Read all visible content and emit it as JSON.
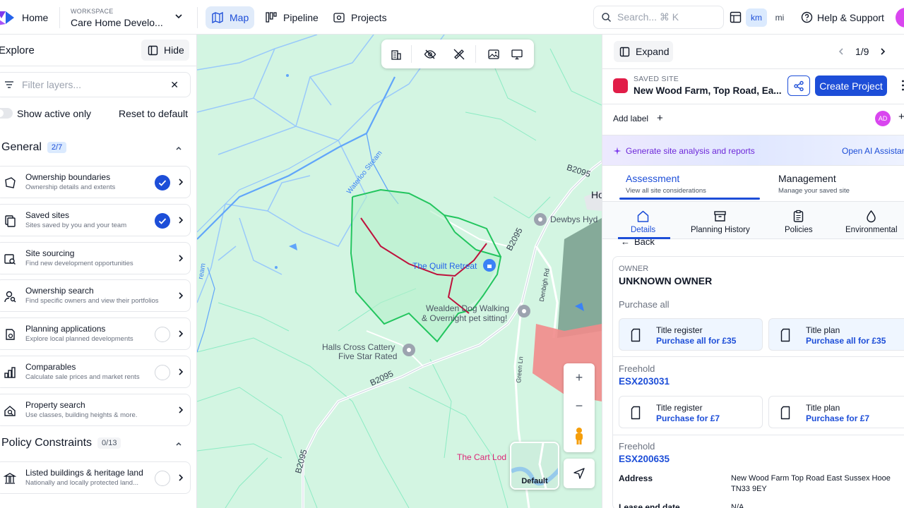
{
  "topbar": {
    "home": "Home",
    "workspace_caption": "WORKSPACE",
    "workspace_name": "Care Home Develo...",
    "nav": [
      {
        "label": "Map",
        "active": true
      },
      {
        "label": "Pipeline",
        "active": false
      },
      {
        "label": "Projects",
        "active": false
      }
    ],
    "search_placeholder": "Search... ⌘ K",
    "units": [
      {
        "label": "km",
        "active": true
      },
      {
        "label": "mi",
        "active": false
      }
    ],
    "help": "Help & Support"
  },
  "explore": {
    "title": "Explore",
    "hide": "Hide",
    "filter_placeholder": "Filter layers...",
    "show_active_only": "Show active only",
    "reset": "Reset to default",
    "sections": [
      {
        "title": "General",
        "badge": "2/7",
        "layers": [
          {
            "title": "Ownership boundaries",
            "subtitle": "Ownership details and extents",
            "checked": true,
            "icon": "boundary-icon"
          },
          {
            "title": "Saved sites",
            "subtitle": "Sites saved by you and your team",
            "checked": true,
            "icon": "saved-sites-icon"
          },
          {
            "title": "Site sourcing",
            "subtitle": "Find new development opportunities",
            "checked": null,
            "icon": "site-sourcing-icon"
          },
          {
            "title": "Ownership search",
            "subtitle": "Find specific owners and view their portfolios",
            "checked": null,
            "icon": "person-search-icon"
          },
          {
            "title": "Planning applications",
            "subtitle": "Explore local planned developments",
            "checked": false,
            "icon": "planning-icon"
          },
          {
            "title": "Comparables",
            "subtitle": "Calculate sale prices and market rents",
            "checked": false,
            "icon": "comparables-icon"
          },
          {
            "title": "Property search",
            "subtitle": "Use classes, building heights & more.",
            "checked": null,
            "icon": "property-search-icon"
          }
        ]
      },
      {
        "title": "Policy Constraints",
        "badge": "0/13",
        "layers": [
          {
            "title": "Listed buildings & heritage land",
            "subtitle": "Nationally and locally protected land...",
            "checked": false,
            "icon": "heritage-icon"
          }
        ]
      }
    ]
  },
  "map": {
    "labels": {
      "road_b2095_top": "B2095",
      "road_b2095_mid": "B2095",
      "road_b2095_low": "B2095",
      "road_b2095_bottom": "B2095",
      "stream": "Waterloo Stream",
      "stream_left": "ream",
      "denbigh": "Denbigh Rd",
      "green_ln": "Green Ln",
      "dewbys": "Dewbys Hyd",
      "quilt": "The Quilt Retreat",
      "wealden_1": "Wealden Dog Walking",
      "wealden_2": "& Overnight pet sitting!",
      "halls_1": "Halls Cross Cattery",
      "halls_2": "Five Star Rated",
      "cart": "The Cart Lod",
      "ho": "Ho"
    },
    "basemap_label": "Default"
  },
  "panel": {
    "expand": "Expand",
    "pager": "1/9",
    "site_caption": "SAVED SITE",
    "site_name": "New Wood Farm, Top Road, Ea...",
    "site_color": "#e11d48",
    "create_project": "Create Project",
    "add_label": "Add label",
    "avatar_initials": "AD",
    "ai_text": "Generate site analysis and reports",
    "ai_link": "Open AI Assistant",
    "tabs": [
      {
        "title": "Assessment",
        "subtitle": "View all site considerations",
        "active": true
      },
      {
        "title": "Management",
        "subtitle": "Manage your saved site",
        "active": false
      }
    ],
    "subtabs": [
      {
        "label": "Details",
        "active": true
      },
      {
        "label": "Planning History",
        "active": false
      },
      {
        "label": "Policies",
        "active": false
      },
      {
        "label": "Environmental",
        "active": false
      }
    ],
    "back": "Back",
    "owner_caption": "OWNER",
    "owner_name": "UNKNOWN OWNER",
    "purchase_all": "Purchase all",
    "purchase_all_cards": [
      {
        "title": "Title register",
        "action": "Purchase all for £35"
      },
      {
        "title": "Title plan",
        "action": "Purchase all for £35"
      }
    ],
    "titles": [
      {
        "tenure": "Freehold",
        "number": "ESX203031",
        "cards": [
          {
            "title": "Title register",
            "action": "Purchase for £7"
          },
          {
            "title": "Title plan",
            "action": "Purchase for £7"
          }
        ]
      },
      {
        "tenure": "Freehold",
        "number": "ESX200635"
      }
    ],
    "address_label": "Address",
    "address_value": "New Wood Farm Top Road East Sussex Hooe TN33 9EY",
    "lease_label": "Lease end date",
    "lease_value": "N/A"
  }
}
